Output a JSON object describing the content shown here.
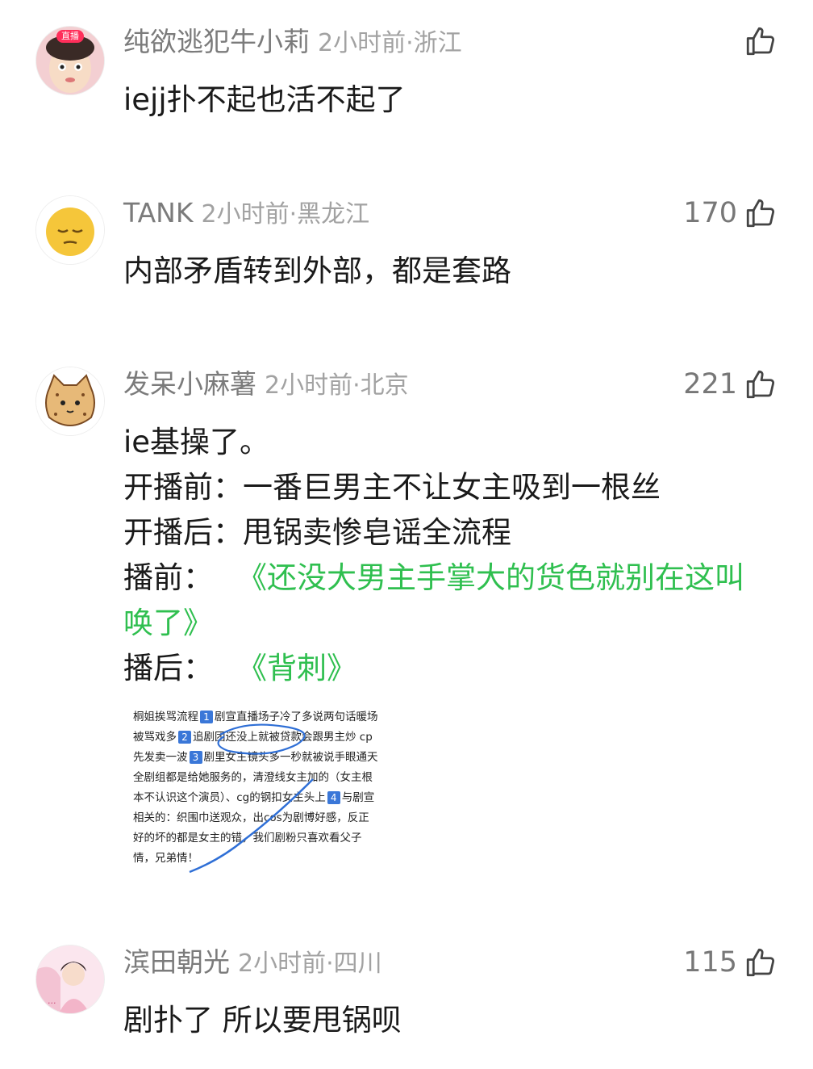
{
  "comments": [
    {
      "user": "纯欲逃犯牛小莉",
      "meta": "2小时前·浙江",
      "likes": "",
      "avatar_badge": "直播",
      "lines": [
        "iejj扑不起也活不起了"
      ]
    },
    {
      "user": "TANK",
      "meta": "2小时前·黑龙江",
      "likes": "170",
      "lines": [
        "内部矛盾转到外部，都是套路"
      ]
    },
    {
      "user": "发呆小麻薯",
      "meta": "2小时前·北京",
      "likes": "221",
      "lines": [
        "ie基操了。",
        "开播前：一番巨男主不让女主吸到一根丝",
        "开播后：甩锅卖惨皂谣全流程",
        "播前：",
        "《还没大男主手掌大的货色就别在这叫",
        "唤了》",
        "播后：",
        "《背刺》"
      ],
      "image_text": [
        "桐姐挨骂流程",
        "1",
        "剧宣直播场子冷了多说两句话暖场",
        "被骂戏多",
        "2",
        "追剧团还没上就被贷款会跟男主炒 cp",
        "先发卖一波",
        "3",
        "剧里女主镜头多一秒就被说手眼通天",
        "全剧组都是给她服务的，清澄线女主加的（女主根",
        "本不认识这个演员）、cg的钢扣女主头上",
        "4",
        "与剧宣",
        "相关的：织围巾送观众，出cos为剧博好感，反正",
        "好的坏的都是女主的错，我们剧粉只喜欢看父子",
        "情，兄弟情！"
      ]
    },
    {
      "user": "滨田朝光",
      "meta": "2小时前·四川",
      "likes": "115",
      "lines": [
        "剧扑了 所以要甩锅呗"
      ]
    }
  ],
  "icons": {
    "like": "thumbs-up-icon"
  },
  "colors": {
    "link_green": "#2fbf4f",
    "username_gray": "#7b7b7b",
    "meta_gray": "#a2a2a2"
  }
}
